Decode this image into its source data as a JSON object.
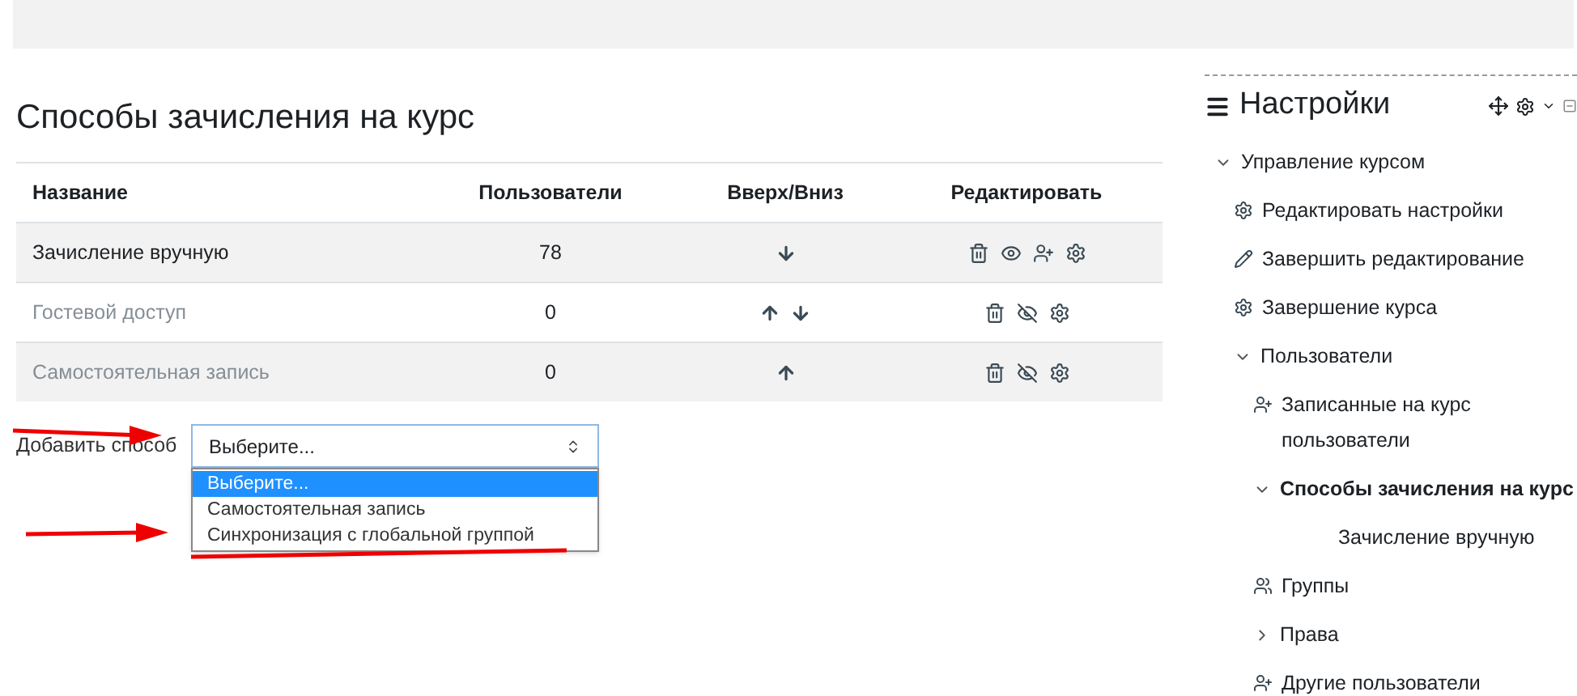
{
  "page_title": "Способы зачисления на курс",
  "table": {
    "columns": [
      "Название",
      "Пользователи",
      "Вверх/Вниз",
      "Редактировать"
    ],
    "rows": [
      {
        "name": "Зачисление вручную",
        "users": "78",
        "disabled": false,
        "up": false,
        "down": true,
        "actions": [
          {
            "kind": "delete"
          },
          {
            "kind": "hide"
          },
          {
            "kind": "enrol"
          },
          {
            "kind": "settings"
          }
        ]
      },
      {
        "name": "Гостевой доступ",
        "users": "0",
        "disabled": true,
        "up": true,
        "down": true,
        "actions": [
          {
            "kind": "delete"
          },
          {
            "kind": "show"
          },
          {
            "kind": "settings"
          }
        ]
      },
      {
        "name": "Самостоятельная запись",
        "users": "0",
        "disabled": true,
        "up": true,
        "down": false,
        "actions": [
          {
            "kind": "delete"
          },
          {
            "kind": "show"
          },
          {
            "kind": "settings"
          }
        ]
      }
    ]
  },
  "add_method": {
    "label": "Добавить способ",
    "value": "Выберите...",
    "expanded": true,
    "options": [
      {
        "label": "Выберите...",
        "selected": true
      },
      {
        "label": "Самостоятельная запись",
        "selected": false
      },
      {
        "label": "Синхронизация с глобальной группой",
        "selected": false
      }
    ]
  },
  "settings_block": {
    "title": "Настройки",
    "tree": [
      {
        "label": "Управление курсом",
        "kind": "folder",
        "expanded": true,
        "children": [
          {
            "label": "Редактировать настройки",
            "kind": "gear"
          },
          {
            "label": "Завершить редактирование",
            "kind": "pencil"
          },
          {
            "label": "Завершение курса",
            "kind": "gear"
          },
          {
            "label": "Пользователи",
            "kind": "folder",
            "expanded": true,
            "children": [
              {
                "label": "Записанные на курс пользователи",
                "kind": "user-plus"
              },
              {
                "label": "Способы зачисления на курс",
                "kind": "folder",
                "expanded": true,
                "selected": true,
                "children": [
                  {
                    "label": "Зачисление вручную",
                    "kind": "leaf"
                  }
                ]
              },
              {
                "label": "Группы",
                "kind": "users"
              },
              {
                "label": "Права",
                "kind": "folder",
                "expanded": false
              },
              {
                "label": "Другие пользователи",
                "kind": "user-plus"
              }
            ]
          }
        ]
      }
    ]
  }
}
